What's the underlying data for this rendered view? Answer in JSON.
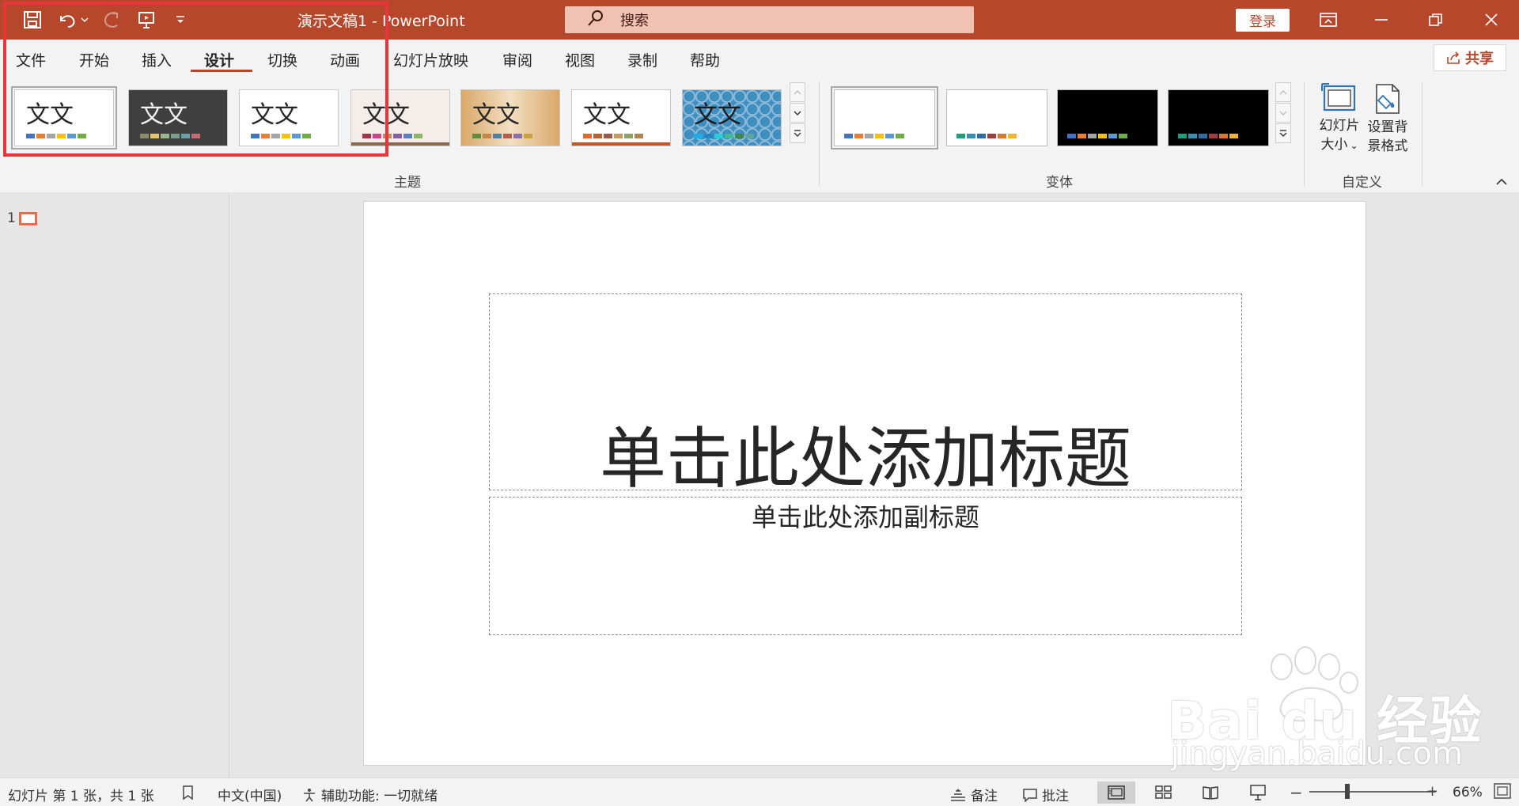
{
  "titlebar": {
    "doc_title": "演示文稿1  -  PowerPoint",
    "search_placeholder": "搜索",
    "login_label": "登录"
  },
  "tabs": [
    {
      "label": "文件"
    },
    {
      "label": "开始"
    },
    {
      "label": "插入"
    },
    {
      "label": "设计",
      "active": true
    },
    {
      "label": "切换"
    },
    {
      "label": "动画"
    },
    {
      "label": "幻灯片放映"
    },
    {
      "label": "审阅"
    },
    {
      "label": "视图"
    },
    {
      "label": "录制"
    },
    {
      "label": "帮助"
    }
  ],
  "share_label": "共享",
  "ribbon": {
    "themes_group": "主题",
    "variants_group": "变体",
    "custom_group": "自定义",
    "theme_sample_text": "文文",
    "slide_size_label_1": "幻灯片",
    "slide_size_label_2": "大小",
    "format_bg_label_1": "设置背",
    "format_bg_label_2": "景格式"
  },
  "themes": [
    {
      "bg": "#ffffff",
      "fg": "#262626",
      "swatches": [
        "#4472c4",
        "#ed7d31",
        "#a5a5a5",
        "#ffc000",
        "#5b9bd5",
        "#70ad47"
      ]
    },
    {
      "bg": "#3f3f3f",
      "fg": "#f2f2f2",
      "swatches": [
        "#8b8b6f",
        "#e3c56d",
        "#9eb68f",
        "#7a9e8a",
        "#6aa0a7",
        "#c36b76"
      ]
    },
    {
      "bg": "#ffffff",
      "fg": "#262626",
      "swatches": [
        "#4472c4",
        "#ed7d31",
        "#a5a5a5",
        "#ffc000",
        "#5b9bd5",
        "#70ad47"
      ]
    },
    {
      "bg": "#f4ede9",
      "fg": "#262626",
      "swatches": [
        "#a5334a",
        "#d2428b",
        "#c28a5a",
        "#8a5ca8",
        "#5c7fbe",
        "#8fb463"
      ]
    },
    {
      "bg": "#e7c79b",
      "fg": "#262626",
      "swatches": [
        "#5f8d3c",
        "#c7854a",
        "#4d7fa7",
        "#b25e4a",
        "#8b6fa8",
        "#c9a340"
      ]
    },
    {
      "bg": "#ffffff",
      "fg": "#262626",
      "swatches": [
        "#e06b2a",
        "#b9622f",
        "#9b5a48",
        "#c49a63",
        "#8fa26b",
        "#b28457"
      ]
    },
    {
      "bg": "#3f8ec2",
      "fg": "#1a1a1a",
      "swatches": [
        "#1cade4",
        "#2683c6",
        "#27ced7",
        "#42ba97",
        "#3e8853",
        "#62a39f"
      ]
    }
  ],
  "variants": [
    {
      "bg": "#ffffff",
      "swatches": [
        "#4472c4",
        "#ed7d31",
        "#a5a5a5",
        "#ffc000",
        "#5b9bd5",
        "#70ad47"
      ]
    },
    {
      "bg": "#ffffff",
      "swatches": [
        "#1e9f7c",
        "#3a8fb5",
        "#2d6ea5",
        "#a33d3d",
        "#e0762b",
        "#f2b530"
      ]
    },
    {
      "bg": "#000000",
      "swatches": [
        "#4472c4",
        "#ed7d31",
        "#a5a5a5",
        "#ffc000",
        "#5b9bd5",
        "#70ad47"
      ]
    },
    {
      "bg": "#000000",
      "swatches": [
        "#1e9f7c",
        "#3a8fb5",
        "#2d6ea5",
        "#a33d3d",
        "#e0762b",
        "#f2b530"
      ]
    }
  ],
  "slide": {
    "number": "1",
    "title_placeholder": "单击此处添加标题",
    "subtitle_placeholder": "单击此处添加副标题"
  },
  "watermark": {
    "brand": "Bai du 经验",
    "url": "jingyan.baidu.com"
  },
  "status": {
    "slide_count": "幻灯片 第 1 张，共 1 张",
    "language": "中文(中国)",
    "accessibility": "辅助功能: 一切就绪",
    "notes": "备注",
    "comments": "批注",
    "zoom": "66%",
    "zoom_fraction": 0.3
  },
  "colors": {
    "accent": "#b7472a",
    "highlight_frame": "#e8343a"
  }
}
